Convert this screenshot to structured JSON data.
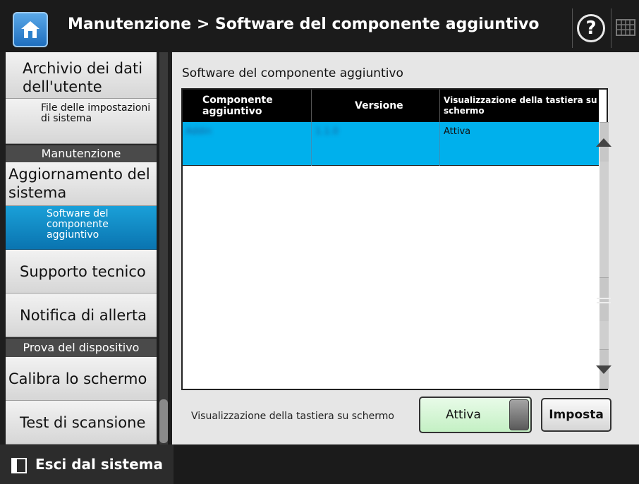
{
  "header": {
    "title": "Manutenzione > Software del componente aggiuntivo",
    "help_glyph": "?"
  },
  "sidebar": {
    "items": [
      {
        "label": "Archivio dei dati dell'utente",
        "type": "item"
      },
      {
        "label": "File delle impostazioni di sistema",
        "type": "subitem"
      },
      {
        "label": "Manutenzione",
        "type": "header"
      },
      {
        "label": "Aggiornamento del sistema",
        "type": "item"
      },
      {
        "label": "Software del componente aggiuntivo",
        "type": "subitem",
        "active": true
      },
      {
        "label": "Supporto tecnico",
        "type": "item"
      },
      {
        "label": "Notifica di allerta",
        "type": "item"
      },
      {
        "label": "Prova del dispositivo",
        "type": "header"
      },
      {
        "label": "Calibra lo schermo",
        "type": "item"
      },
      {
        "label": "Test di scansione",
        "type": "item"
      }
    ]
  },
  "main": {
    "section_title": "Software del componente aggiuntivo",
    "table": {
      "headers": [
        "Componente aggiuntivo",
        "Versione",
        "Visualizzazione della tastiera su schermo"
      ],
      "rows": [
        {
          "component": "Addin",
          "version": "1.1.0",
          "keyboard": "Attiva",
          "selected": true
        }
      ]
    },
    "osk_label": "Visualizzazione della tastiera su schermo",
    "toggle_value": "Attiva",
    "set_button": "Imposta"
  },
  "footer": {
    "logout_label": "Esci dal sistema"
  },
  "colors": {
    "accent": "#0a74b0",
    "row_selected": "#00b0ec",
    "toggle_on": "#c4f0c4"
  }
}
